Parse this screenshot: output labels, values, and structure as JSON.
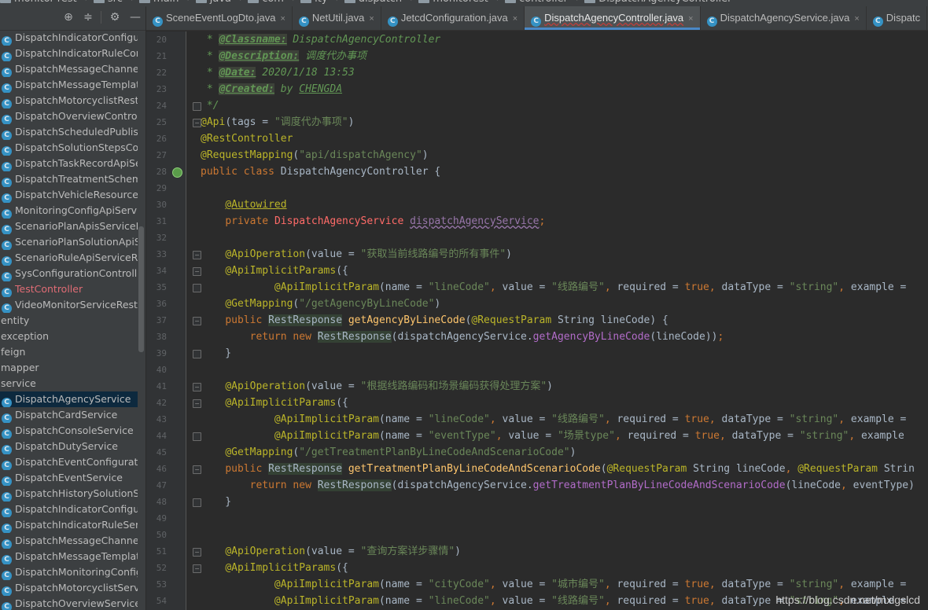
{
  "breadcrumb": [
    "monitor-rest",
    "src",
    "main",
    "java",
    "com",
    "ity",
    "dispatch",
    "monitorest",
    "controller",
    "DispatchAgencyController"
  ],
  "project_toolbar": {
    "icons": [
      "crosshair-icon",
      "collapse-all-icon",
      "gear-icon",
      "minimize-icon"
    ]
  },
  "project_tree": [
    {
      "label": "DispatchIndicatorConfigurati",
      "kind": "class"
    },
    {
      "label": "DispatchIndicatorRuleContro",
      "kind": "class"
    },
    {
      "label": "DispatchMessageChannelCor",
      "kind": "class"
    },
    {
      "label": "DispatchMessageTemplateCc",
      "kind": "class"
    },
    {
      "label": "DispatchMotorcyclistRest",
      "kind": "class"
    },
    {
      "label": "DispatchOverviewController",
      "kind": "class"
    },
    {
      "label": "DispatchScheduledPublished",
      "kind": "class"
    },
    {
      "label": "DispatchSolutionStepsContro",
      "kind": "class"
    },
    {
      "label": "DispatchTaskRecordApiServi",
      "kind": "class"
    },
    {
      "label": "DispatchTreatmentSchemeCo",
      "kind": "class"
    },
    {
      "label": "DispatchVehicleResourceRest",
      "kind": "class"
    },
    {
      "label": "MonitoringConfigApiServiceR",
      "kind": "class"
    },
    {
      "label": "ScenarioPlanApisServiceRest",
      "kind": "class"
    },
    {
      "label": "ScenarioPlanSolutionApiServi",
      "kind": "class"
    },
    {
      "label": "ScenarioRuleApiServiceRest",
      "kind": "class"
    },
    {
      "label": "SysConfigurationController",
      "kind": "class"
    },
    {
      "label": "TestController",
      "kind": "class",
      "error": true
    },
    {
      "label": "VideoMonitorServiceRest",
      "kind": "class"
    },
    {
      "label": "entity",
      "kind": "folder"
    },
    {
      "label": "exception",
      "kind": "folder"
    },
    {
      "label": "feign",
      "kind": "folder"
    },
    {
      "label": "mapper",
      "kind": "folder"
    },
    {
      "label": "service",
      "kind": "folder"
    },
    {
      "label": "DispatchAgencyService",
      "kind": "class",
      "selected": true
    },
    {
      "label": "DispatchCardService",
      "kind": "class"
    },
    {
      "label": "DispatchConsoleService",
      "kind": "class"
    },
    {
      "label": "DispatchDutyService",
      "kind": "class"
    },
    {
      "label": "DispatchEventConfigurationS",
      "kind": "class"
    },
    {
      "label": "DispatchEventService",
      "kind": "class"
    },
    {
      "label": "DispatchHistorySolutionServi",
      "kind": "class"
    },
    {
      "label": "DispatchIndicatorConfigurati",
      "kind": "class"
    },
    {
      "label": "DispatchIndicatorRuleService",
      "kind": "class"
    },
    {
      "label": "DispatchMessageChannelSer",
      "kind": "class"
    },
    {
      "label": "DispatchMessageTemplateSe",
      "kind": "class"
    },
    {
      "label": "DispatchMonitoringConfigSe",
      "kind": "class"
    },
    {
      "label": "DispatchMotorcyclistService",
      "kind": "class"
    },
    {
      "label": "DispatchOverviewService",
      "kind": "class"
    }
  ],
  "tabs": [
    {
      "title": "SceneEventLogDto.java",
      "active": false,
      "close": "×"
    },
    {
      "title": "NetUtil.java",
      "active": false,
      "close": "×"
    },
    {
      "title": "JetcdConfiguration.java",
      "active": false,
      "close": "×"
    },
    {
      "title": "DispatchAgencyController.java",
      "active": true,
      "close": "×"
    },
    {
      "title": "DispatchAgencyService.java",
      "active": false,
      "close": "×"
    },
    {
      "title": "Dispatc",
      "active": false,
      "close": ""
    }
  ],
  "code_lines": [
    {
      "n": "20",
      "fold": "",
      "tokens": [
        [
          "c",
          " * "
        ],
        [
          "tag",
          "@Classname:"
        ],
        [
          "c",
          " DispatchAgencyController"
        ]
      ]
    },
    {
      "n": "21",
      "fold": "",
      "tokens": [
        [
          "c",
          " * "
        ],
        [
          "tag",
          "@Description:"
        ],
        [
          "c",
          " 调度代办事项"
        ]
      ]
    },
    {
      "n": "22",
      "fold": "",
      "tokens": [
        [
          "c",
          " * "
        ],
        [
          "tag",
          "@Date:"
        ],
        [
          "c",
          " 2020/1/18 13:53"
        ]
      ]
    },
    {
      "n": "23",
      "fold": "",
      "tokens": [
        [
          "c",
          " * "
        ],
        [
          "tag",
          "@Created:"
        ],
        [
          "c",
          " by "
        ],
        [
          "cn",
          "CHENGDA"
        ]
      ]
    },
    {
      "n": "24",
      "fold": "end",
      "tokens": [
        [
          "c",
          " */"
        ]
      ]
    },
    {
      "n": "25",
      "fold": "start",
      "tokens": [
        [
          "a",
          "@Api"
        ],
        [
          "p",
          "(tags = "
        ],
        [
          "s",
          "\"调度代办事项\""
        ],
        [
          "p",
          ")"
        ]
      ]
    },
    {
      "n": "26",
      "fold": "",
      "tokens": [
        [
          "a",
          "@RestController"
        ]
      ]
    },
    {
      "n": "27",
      "fold": "",
      "tokens": [
        [
          "a",
          "@RequestMapping"
        ],
        [
          "p",
          "("
        ],
        [
          "s",
          "\"api/dispatchAgency\""
        ],
        [
          "p",
          ")"
        ]
      ]
    },
    {
      "n": "28",
      "fold": "",
      "bean": true,
      "tokens": [
        [
          "k",
          "public class "
        ],
        [
          "p",
          "DispatchAgencyController {"
        ]
      ]
    },
    {
      "n": "29",
      "fold": "",
      "tokens": []
    },
    {
      "n": "30",
      "fold": "",
      "tokens": [
        [
          "p",
          "    "
        ],
        [
          "a_u",
          "@Autowired"
        ]
      ]
    },
    {
      "n": "31",
      "fold": "",
      "tokens": [
        [
          "p",
          "    "
        ],
        [
          "k",
          "private "
        ],
        [
          "cls",
          "DispatchAgencyService "
        ],
        [
          "f",
          "dispatchAgencyService"
        ],
        [
          "k",
          ";"
        ]
      ]
    },
    {
      "n": "32",
      "fold": "",
      "tokens": []
    },
    {
      "n": "33",
      "fold": "start",
      "tokens": [
        [
          "p",
          "    "
        ],
        [
          "a",
          "@ApiOperation"
        ],
        [
          "p",
          "(value = "
        ],
        [
          "s",
          "\"获取当前线路编号的所有事件\""
        ],
        [
          "p",
          ")"
        ]
      ]
    },
    {
      "n": "34",
      "fold": "start",
      "tokens": [
        [
          "p",
          "    "
        ],
        [
          "a",
          "@ApiImplicitParams"
        ],
        [
          "p",
          "({"
        ]
      ]
    },
    {
      "n": "35",
      "fold": "end",
      "tokens": [
        [
          "p",
          "            "
        ],
        [
          "a",
          "@ApiImplicitParam"
        ],
        [
          "p",
          "(name = "
        ],
        [
          "s",
          "\"lineCode\""
        ],
        [
          "k",
          ", "
        ],
        [
          "p",
          "value = "
        ],
        [
          "s",
          "\"线路编号\""
        ],
        [
          "k",
          ", "
        ],
        [
          "p",
          "required = "
        ],
        [
          "k",
          "true"
        ],
        [
          "k",
          ", "
        ],
        [
          "p",
          "dataType = "
        ],
        [
          "s",
          "\"string\""
        ],
        [
          "k",
          ", "
        ],
        [
          "p",
          "example = "
        ]
      ]
    },
    {
      "n": "36",
      "fold": "",
      "tokens": [
        [
          "p",
          "    "
        ],
        [
          "a",
          "@GetMapping"
        ],
        [
          "p",
          "("
        ],
        [
          "s",
          "\"/getAgencyByLineCode\""
        ],
        [
          "p",
          ")"
        ]
      ]
    },
    {
      "n": "37",
      "fold": "start",
      "tokens": [
        [
          "p",
          "    "
        ],
        [
          "k",
          "public "
        ],
        [
          "hl",
          "RestResponse"
        ],
        [
          "p",
          " "
        ],
        [
          "m",
          "getAgencyByLineCode"
        ],
        [
          "p",
          "("
        ],
        [
          "a",
          "@RequestParam "
        ],
        [
          "p",
          "String lineCode) {"
        ]
      ]
    },
    {
      "n": "38",
      "fold": "",
      "tokens": [
        [
          "p",
          "        "
        ],
        [
          "k",
          "return new "
        ],
        [
          "hl",
          "RestResponse"
        ],
        [
          "p",
          "(dispatchAgencyService."
        ],
        [
          "mc",
          "getAgencyByLineCode"
        ],
        [
          "p",
          "(lineCode))"
        ],
        [
          "k",
          ";"
        ]
      ]
    },
    {
      "n": "39",
      "fold": "end",
      "tokens": [
        [
          "p",
          "    }"
        ]
      ]
    },
    {
      "n": "40",
      "fold": "",
      "tokens": []
    },
    {
      "n": "41",
      "fold": "start",
      "tokens": [
        [
          "p",
          "    "
        ],
        [
          "a",
          "@ApiOperation"
        ],
        [
          "p",
          "(value = "
        ],
        [
          "s",
          "\"根据线路编码和场景编码获得处理方案\""
        ],
        [
          "p",
          ")"
        ]
      ]
    },
    {
      "n": "42",
      "fold": "start",
      "tokens": [
        [
          "p",
          "    "
        ],
        [
          "a",
          "@ApiImplicitParams"
        ],
        [
          "p",
          "({"
        ]
      ]
    },
    {
      "n": "43",
      "fold": "",
      "tokens": [
        [
          "p",
          "            "
        ],
        [
          "a",
          "@ApiImplicitParam"
        ],
        [
          "p",
          "(name = "
        ],
        [
          "s",
          "\"lineCode\""
        ],
        [
          "k",
          ", "
        ],
        [
          "p",
          "value = "
        ],
        [
          "s",
          "\"线路编号\""
        ],
        [
          "k",
          ", "
        ],
        [
          "p",
          "required = "
        ],
        [
          "k",
          "true"
        ],
        [
          "k",
          ", "
        ],
        [
          "p",
          "dataType = "
        ],
        [
          "s",
          "\"string\""
        ],
        [
          "k",
          ", "
        ],
        [
          "p",
          "example = "
        ]
      ]
    },
    {
      "n": "44",
      "fold": "end",
      "tokens": [
        [
          "p",
          "            "
        ],
        [
          "a",
          "@ApiImplicitParam"
        ],
        [
          "p",
          "(name = "
        ],
        [
          "s",
          "\"eventType\""
        ],
        [
          "k",
          ", "
        ],
        [
          "p",
          "value = "
        ],
        [
          "s",
          "\"场景type\""
        ],
        [
          "k",
          ", "
        ],
        [
          "p",
          "required = "
        ],
        [
          "k",
          "true"
        ],
        [
          "k",
          ", "
        ],
        [
          "p",
          "dataType = "
        ],
        [
          "s",
          "\"string\""
        ],
        [
          "k",
          ", "
        ],
        [
          "p",
          "example"
        ]
      ]
    },
    {
      "n": "45",
      "fold": "",
      "tokens": [
        [
          "p",
          "    "
        ],
        [
          "a",
          "@GetMapping"
        ],
        [
          "p",
          "("
        ],
        [
          "s",
          "\"/getTreatmentPlanByLineCodeAndScenarioCode\""
        ],
        [
          "p",
          ")"
        ]
      ]
    },
    {
      "n": "46",
      "fold": "start",
      "tokens": [
        [
          "p",
          "    "
        ],
        [
          "k",
          "public "
        ],
        [
          "hl",
          "RestResponse"
        ],
        [
          "p",
          " "
        ],
        [
          "m",
          "getTreatmentPlanByLineCodeAndScenarioCode"
        ],
        [
          "p",
          "("
        ],
        [
          "a",
          "@RequestParam "
        ],
        [
          "p",
          "String lineCode"
        ],
        [
          "k",
          ", "
        ],
        [
          "a",
          "@RequestParam "
        ],
        [
          "p",
          "Strin"
        ]
      ]
    },
    {
      "n": "47",
      "fold": "",
      "tokens": [
        [
          "p",
          "        "
        ],
        [
          "k",
          "return new "
        ],
        [
          "hl",
          "RestResponse"
        ],
        [
          "p",
          "(dispatchAgencyService."
        ],
        [
          "mc",
          "getTreatmentPlanByLineCodeAndScenarioCode"
        ],
        [
          "p",
          "(lineCode"
        ],
        [
          "k",
          ", "
        ],
        [
          "p",
          "eventType)"
        ]
      ]
    },
    {
      "n": "48",
      "fold": "end",
      "tokens": [
        [
          "p",
          "    }"
        ]
      ]
    },
    {
      "n": "49",
      "fold": "",
      "tokens": []
    },
    {
      "n": "50",
      "fold": "",
      "tokens": []
    },
    {
      "n": "51",
      "fold": "start",
      "tokens": [
        [
          "p",
          "    "
        ],
        [
          "a",
          "@ApiOperation"
        ],
        [
          "p",
          "(value = "
        ],
        [
          "s",
          "\"查询方案详步骤情\""
        ],
        [
          "p",
          ")"
        ]
      ]
    },
    {
      "n": "52",
      "fold": "start",
      "tokens": [
        [
          "p",
          "    "
        ],
        [
          "a",
          "@ApiImplicitParams"
        ],
        [
          "p",
          "({"
        ]
      ]
    },
    {
      "n": "53",
      "fold": "",
      "tokens": [
        [
          "p",
          "            "
        ],
        [
          "a",
          "@ApiImplicitParam"
        ],
        [
          "p",
          "(name = "
        ],
        [
          "s",
          "\"cityCode\""
        ],
        [
          "k",
          ", "
        ],
        [
          "p",
          "value = "
        ],
        [
          "s",
          "\"城市编号\""
        ],
        [
          "k",
          ", "
        ],
        [
          "p",
          "required = "
        ],
        [
          "k",
          "true"
        ],
        [
          "k",
          ", "
        ],
        [
          "p",
          "dataType = "
        ],
        [
          "s",
          "\"string\""
        ],
        [
          "k",
          ", "
        ],
        [
          "p",
          "example = "
        ]
      ]
    },
    {
      "n": "54",
      "fold": "",
      "tokens": [
        [
          "p",
          "            "
        ],
        [
          "a",
          "@ApiImplicitParam"
        ],
        [
          "p",
          "(name = "
        ],
        [
          "s",
          "\"lineCode\""
        ],
        [
          "k",
          ", "
        ],
        [
          "p",
          "value = "
        ],
        [
          "s",
          "\"线路编号\""
        ],
        [
          "k",
          ", "
        ],
        [
          "p",
          "required = "
        ],
        [
          "k",
          "true"
        ],
        [
          "k",
          ", "
        ],
        [
          "p",
          "dataType = "
        ],
        [
          "s",
          "\"string\""
        ],
        [
          "k",
          ", "
        ],
        [
          "p",
          "example = "
        ]
      ]
    }
  ],
  "watermark": "https://blog.csdn.net/mxlgslcd"
}
